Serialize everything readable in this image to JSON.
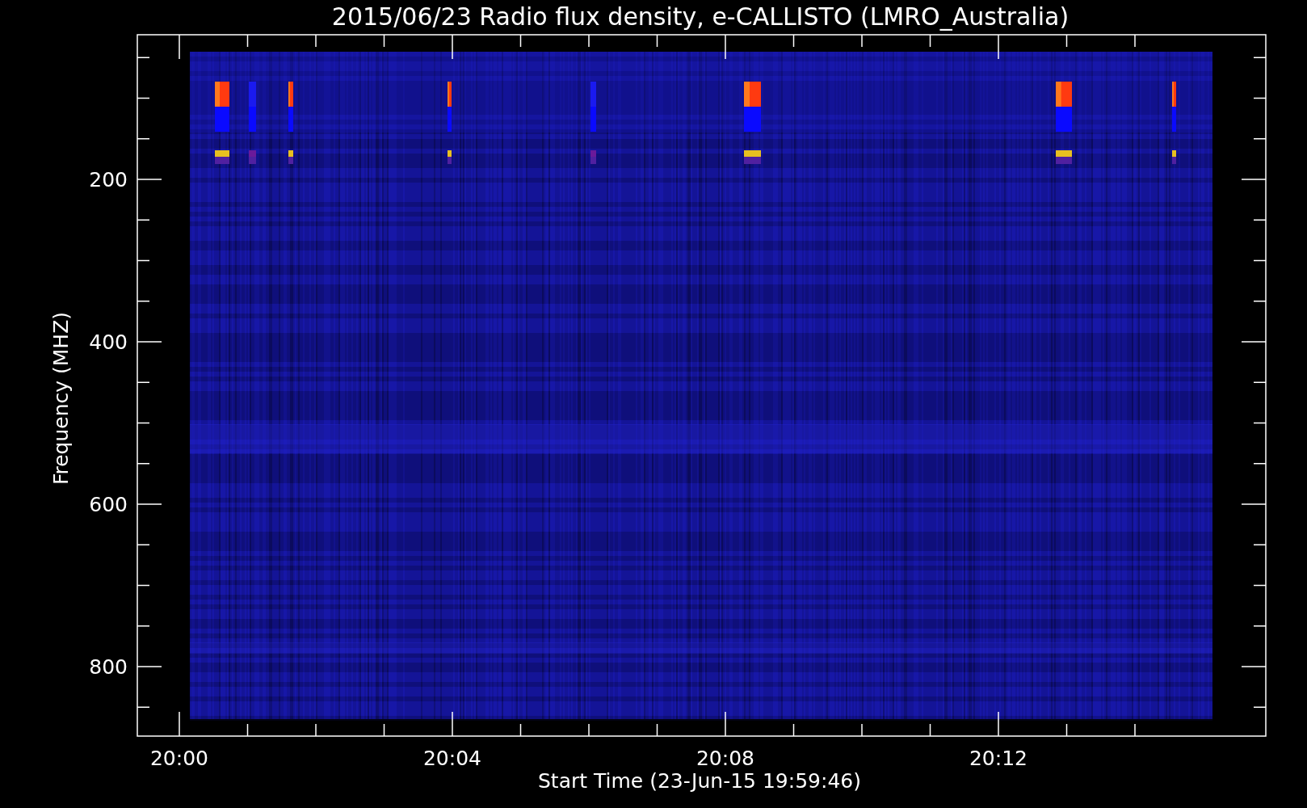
{
  "title": "2015/06/23  Radio flux density, e-CALLISTO (LMRO_Australia)",
  "plot": {
    "ylabel": "Frequency (MHZ)",
    "xlabel": "Start Time (23-Jun-15 19:59:46)",
    "yticks": [
      "200",
      "400",
      "600",
      "800"
    ],
    "xticks": [
      "20:00",
      "20:04",
      "20:08",
      "20:12"
    ]
  }
}
